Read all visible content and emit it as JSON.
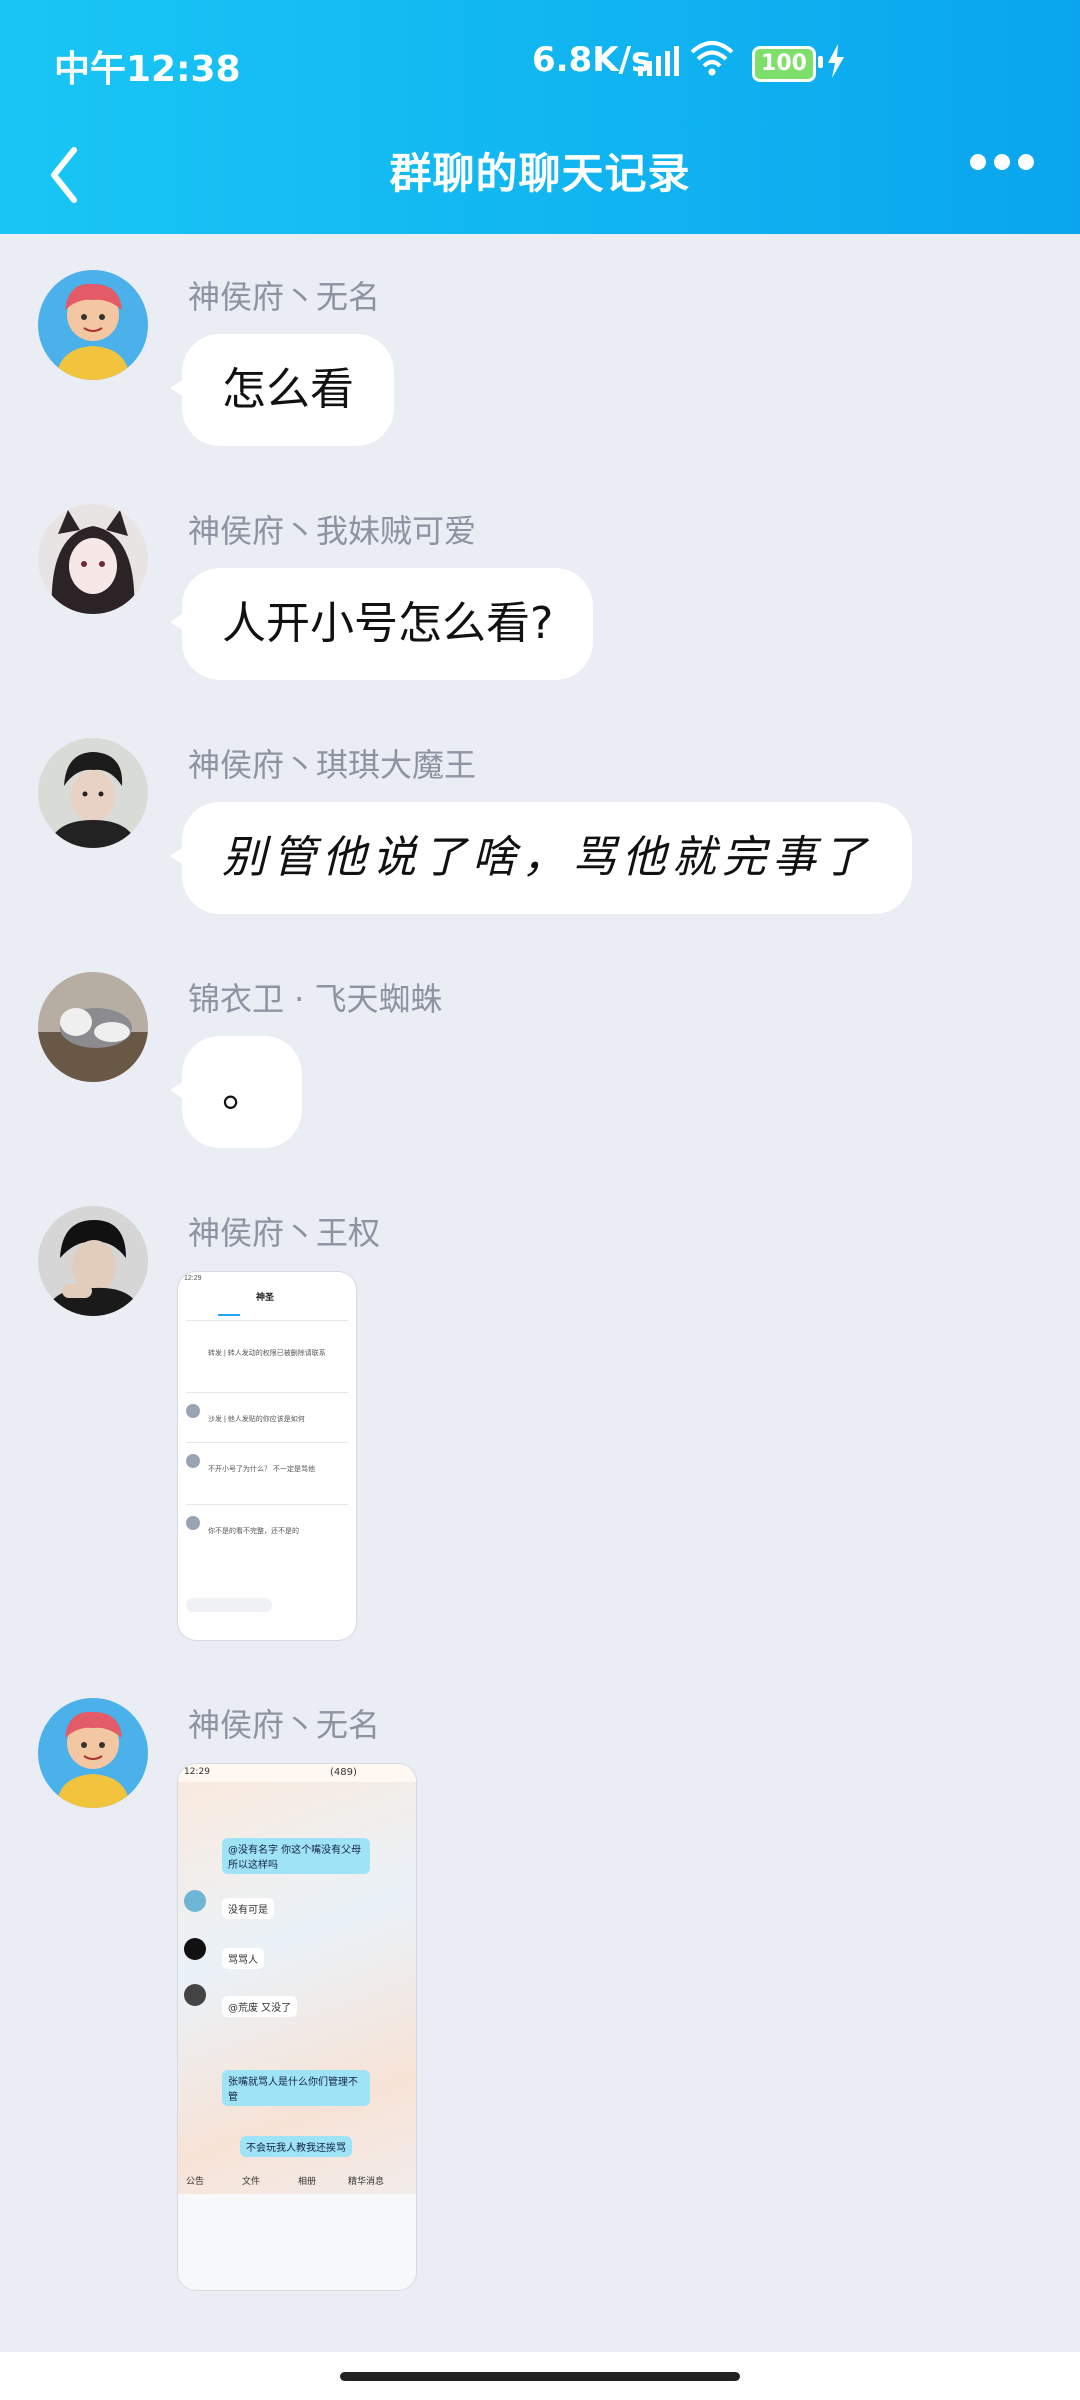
{
  "status_bar": {
    "time": "中午12:38",
    "net_speed": "6.8K/s",
    "battery": "100",
    "icons": [
      "signal-icon",
      "wifi-icon",
      "battery-icon",
      "charging-icon"
    ]
  },
  "nav": {
    "title": "群聊的聊天记录",
    "back_icon": "chevron-left-icon",
    "more_icon": "more-dots-icon"
  },
  "messages": [
    {
      "sender": "神侯府丶无名",
      "type": "text",
      "text": "怎么看"
    },
    {
      "sender": "神侯府丶我妹贼可爱",
      "type": "text",
      "text": "人开小号怎么看?"
    },
    {
      "sender": "神侯府丶琪琪大魔王",
      "type": "text",
      "text": "别管他说了啥，骂他就完事了"
    },
    {
      "sender": "锦衣卫 · 飞天蜘蛛",
      "type": "text",
      "text": "。"
    },
    {
      "sender": "神侯府丶王权",
      "type": "image"
    },
    {
      "sender": "神侯府丶无名",
      "type": "image"
    }
  ],
  "screenshot1": {
    "time": "12:29",
    "title": "神圣",
    "items": [
      "转发 | 转人发动的权限已被删除请联系",
      "沙发 | 他人发贴的你应该是如何",
      "不开小号了为什么？ 不一定是骂他",
      "你不是的看不完整，还不是的"
    ]
  },
  "screenshot2": {
    "time": "12:29",
    "count": "(489)",
    "bubbles": [
      "@没有名字 你这个嘴没有父母所以这样吗",
      "没有可是",
      "骂骂人",
      "@荒废 又没了",
      "张嘴就骂人是什么你们管理不管",
      "不会玩我人教我还挨骂"
    ],
    "toolbar": [
      "公告",
      "文件",
      "相册",
      "精华消息"
    ]
  }
}
